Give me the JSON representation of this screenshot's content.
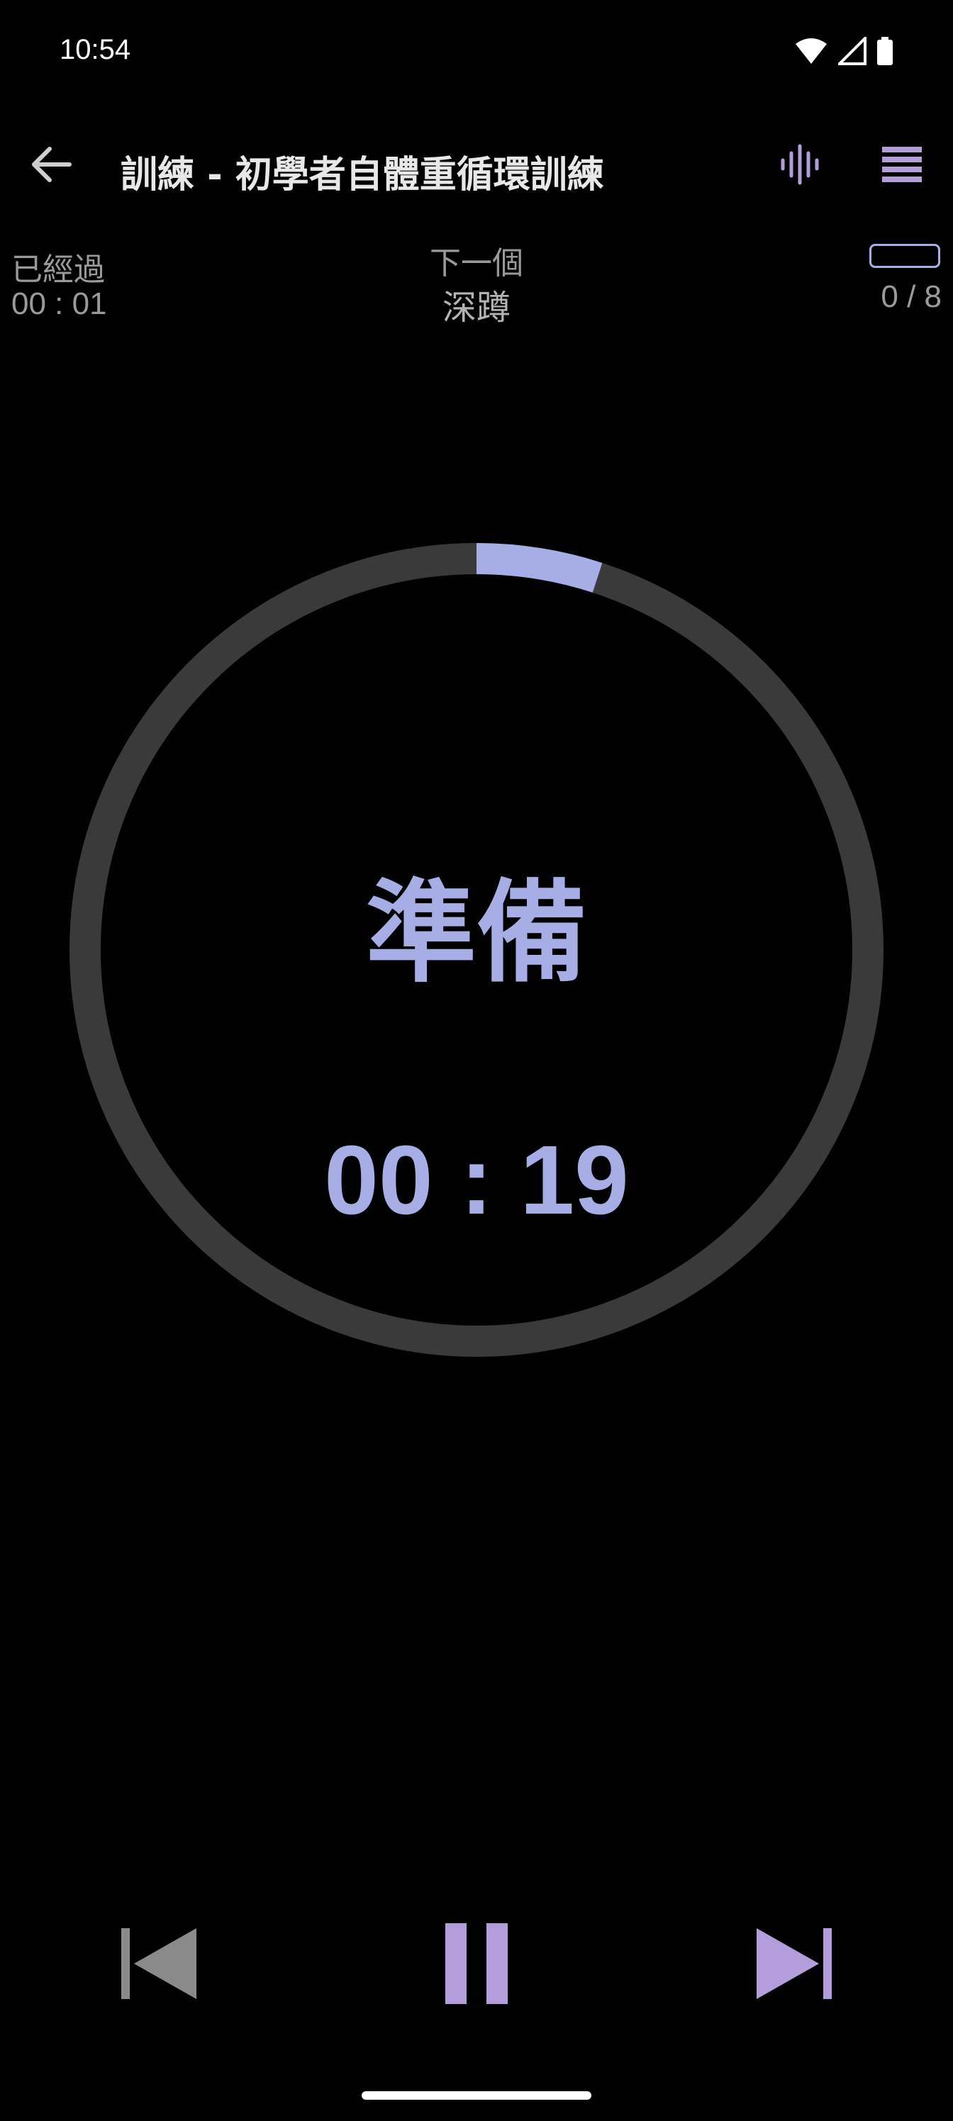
{
  "status_bar": {
    "time": "10:54",
    "icons": [
      "wifi-icon",
      "signal-icon",
      "battery-icon"
    ]
  },
  "app_bar": {
    "title": "訓練 - 初學者自體重循環訓練",
    "icons": [
      "back-arrow-icon",
      "audio-wave-icon",
      "menu-icon"
    ]
  },
  "info": {
    "elapsed_label": "已經過",
    "elapsed_value": "00 : 01",
    "next_label": "下一個",
    "next_value": "深蹲",
    "progress_count": "0 / 8",
    "progress_fraction": 0
  },
  "timer": {
    "phase": "準備",
    "countdown": "00 : 19",
    "ring_progress_fraction": 0.05
  },
  "controls": {
    "icons": [
      "skip-previous-icon",
      "pause-icon",
      "skip-next-icon"
    ]
  },
  "colors": {
    "background": "#000000",
    "accent_blue": "#a7aee6",
    "accent_purple": "#b39ddb",
    "ring_track": "#3a3a3a",
    "muted_text": "#9a9a9a",
    "disabled_control": "#8a8a8a"
  }
}
